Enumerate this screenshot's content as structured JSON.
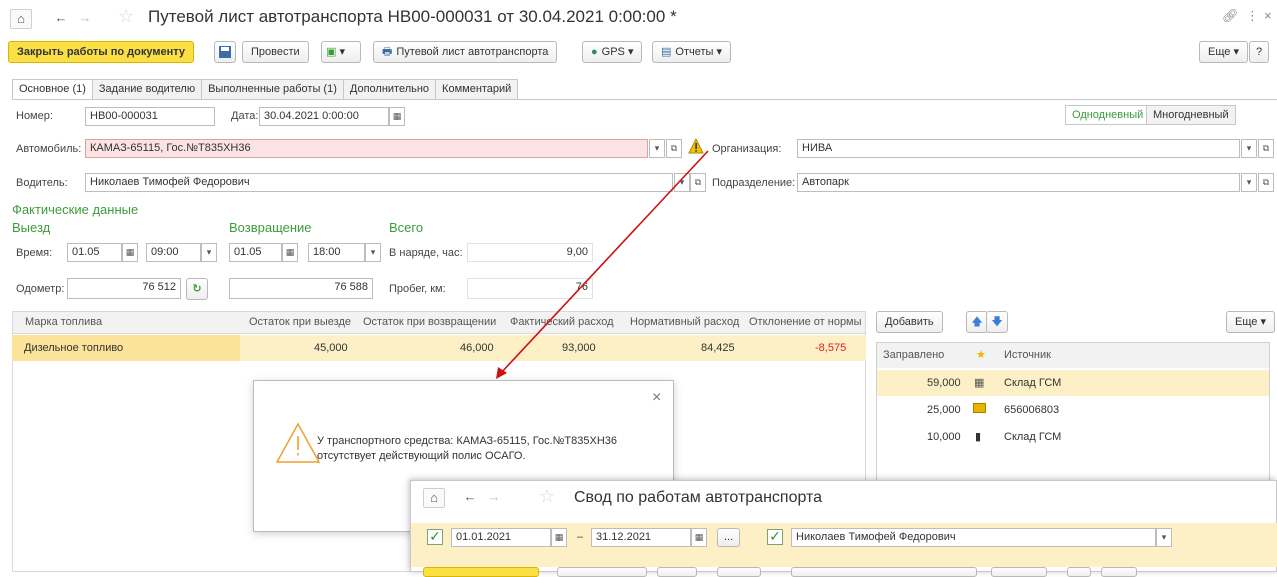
{
  "title": "Путевой лист автотранспорта НВ00-000031 от 30.04.2021 0:00:00 *",
  "toolbar": {
    "close_work": "Закрыть работы по документу",
    "post": "Провести",
    "print_waybill": "Путевой лист автотранспорта",
    "gps": "GPS",
    "reports": "Отчеты",
    "more": "Еще",
    "help": "?"
  },
  "tabs": [
    "Основное (1)",
    "Задание водителю",
    "Выполненные работы (1)",
    "Дополнительно",
    "Комментарий"
  ],
  "form": {
    "number_label": "Номер:",
    "number": "НВ00-000031",
    "date_label": "Дата:",
    "date": "30.04.2021  0:00:00",
    "car_label": "Автомобиль:",
    "car": "КАМАЗ-65115, Гос.№Т835ХН36",
    "driver_label": "Водитель:",
    "driver": "Николаев Тимофей Федорович",
    "org_label": "Организация:",
    "org": "НИВА",
    "dept_label": "Подразделение:",
    "dept": "Автопарк",
    "one_day": "Однодневный",
    "multi_day": "Многодневный"
  },
  "actual": {
    "title": "Фактические данные",
    "departure": "Выезд",
    "return": "Возвращение",
    "total": "Всего",
    "time_label": "Время:",
    "dep_date": "01.05",
    "dep_time": "09:00",
    "ret_date": "01.05",
    "ret_time": "18:00",
    "hours_label": "В наряде, час:",
    "hours": "9,00",
    "odometer_label": "Одометр:",
    "odo_dep": "76 512",
    "odo_ret": "76 588",
    "mileage_label": "Пробег, км:",
    "mileage": "76"
  },
  "fuel_table": {
    "headers": [
      "Марка топлива",
      "Остаток при выезде",
      "Остаток при возвращении",
      "Фактический расход",
      "Нормативный расход",
      "Отклонение от нормы"
    ],
    "rows": [
      [
        "Дизельное топливо",
        "45,000",
        "46,000",
        "93,000",
        "84,425",
        "-8,575"
      ]
    ]
  },
  "refuel": {
    "add": "Добавить",
    "more": "Еще",
    "headers": [
      "Заправлено",
      "Источник"
    ],
    "rows": [
      {
        "amount": "59,000",
        "source": "Склад ГСМ",
        "icon": "warehouse-icon"
      },
      {
        "amount": "25,000",
        "source": "656006803",
        "icon": "fuel-card-icon"
      },
      {
        "amount": "10,000",
        "source": "Склад ГСМ",
        "icon": "fuel-pump-icon"
      }
    ]
  },
  "alert": {
    "line1": "У транспортного средства: КАМАЗ-65115, Гос.№Т835ХН36",
    "line2": "отсутствует действующий полис ОСАГО."
  },
  "report_window": {
    "title": "Свод по работам автотранспорта",
    "date_from": "01.01.2021",
    "dash": "–",
    "date_to": "31.12.2021",
    "dots": "...",
    "driver": "Николаев Тимофей Федорович"
  },
  "colors": {
    "accent_yellow": "#fbe045",
    "green": "#3c9c3c",
    "negative": "#e02020",
    "arrow": "#cc1111"
  }
}
